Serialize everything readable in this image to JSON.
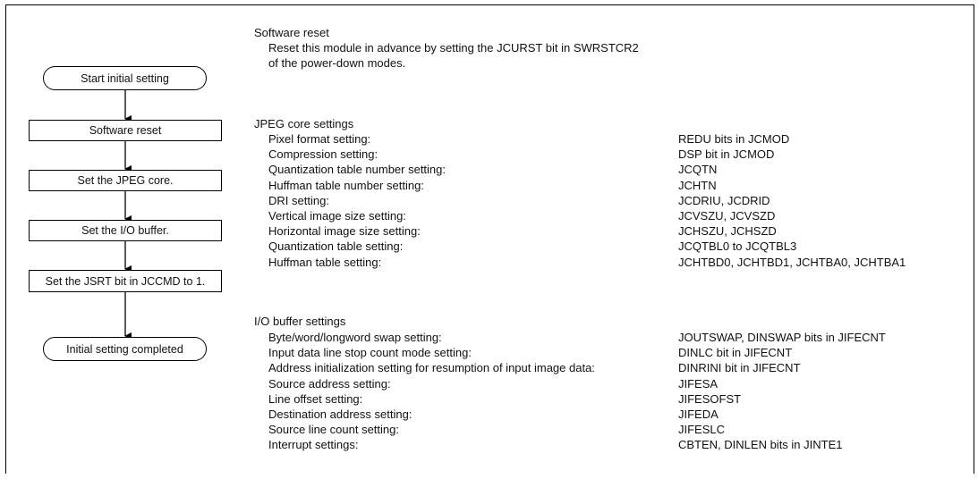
{
  "flowchart": {
    "nodes": [
      {
        "label": "Start initial setting",
        "shape": "terminal"
      },
      {
        "label": "Software reset",
        "shape": "process"
      },
      {
        "label": "Set the JPEG core.",
        "shape": "process"
      },
      {
        "label": "Set the I/O buffer.",
        "shape": "process"
      },
      {
        "label": "Set the JSRT bit in JCCMD to 1.",
        "shape": "process"
      },
      {
        "label": "Initial setting completed",
        "shape": "terminal"
      }
    ]
  },
  "software_reset": {
    "title": "Software reset",
    "line1": "Reset this module in advance by setting the JCURST bit in SWRSTCR2",
    "line2": "of the power-down modes."
  },
  "jpeg_core": {
    "title": "JPEG core settings",
    "rows": [
      {
        "label": "Pixel format setting:",
        "value": "REDU bits in JCMOD"
      },
      {
        "label": "Compression setting:",
        "value": "DSP bit in JCMOD"
      },
      {
        "label": "Quantization table number setting:",
        "value": "JCQTN"
      },
      {
        "label": "Huffman table number setting:",
        "value": "JCHTN"
      },
      {
        "label": "DRI setting:",
        "value": "JCDRIU, JCDRID"
      },
      {
        "label": "Vertical image size setting:",
        "value": "JCVSZU, JCVSZD"
      },
      {
        "label": "Horizontal image size setting:",
        "value": "JCHSZU, JCHSZD"
      },
      {
        "label": "Quantization table setting:",
        "value": "JCQTBL0 to JCQTBL3"
      },
      {
        "label": "Huffman table setting:",
        "value": "JCHTBD0, JCHTBD1, JCHTBA0, JCHTBA1"
      }
    ]
  },
  "io_buffer": {
    "title": "I/O buffer settings",
    "rows": [
      {
        "label": "Byte/word/longword swap setting:",
        "value": "JOUTSWAP, DINSWAP bits in JIFECNT"
      },
      {
        "label": "Input data line stop count mode setting:",
        "value": "DINLC bit in JIFECNT"
      },
      {
        "label": "Address initialization setting for resumption of input image data:",
        "value": "DINRINI bit in JIFECNT"
      },
      {
        "label": "Source address setting:",
        "value": "JIFESA"
      },
      {
        "label": "Line offset setting:",
        "value": "JIFESOFST"
      },
      {
        "label": "Destination address setting:",
        "value": "JIFEDA"
      },
      {
        "label": "Source line count setting:",
        "value": "JIFESLC"
      },
      {
        "label": "Interrupt settings:",
        "value": "CBTEN, DINLEN bits in JINTE1"
      }
    ]
  }
}
